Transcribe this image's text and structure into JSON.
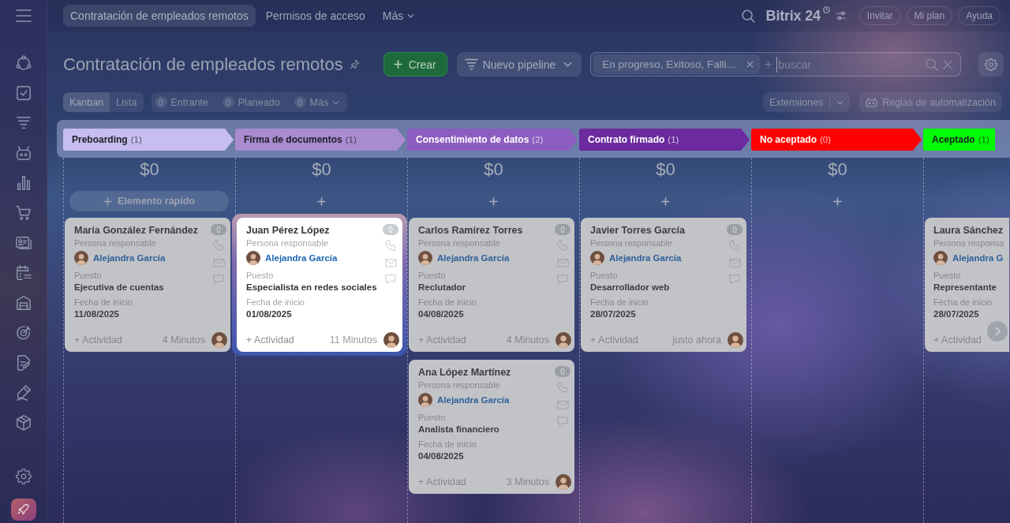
{
  "top_tabs": [
    {
      "label": "Contratación de empleados remotos",
      "kind": "tab",
      "selected": true
    },
    {
      "label": "Permisos de acceso",
      "kind": "tab",
      "selected": false
    },
    {
      "label": "Más",
      "kind": "menu",
      "selected": false
    }
  ],
  "header": {
    "logo": "Bitrix 24",
    "buttons": [
      "Invitar",
      "Mi plan",
      "Ayuda"
    ]
  },
  "page": {
    "title": "Contratación de empleados remotos",
    "create_button": "Crear",
    "pipeline_button": "Nuevo pipeline",
    "filter": {
      "tag": "En progreso, Exitoso, Falli...",
      "placeholder": "buscar"
    }
  },
  "views": [
    {
      "label": "Kanban",
      "selected": true
    },
    {
      "label": "Lista",
      "selected": false
    }
  ],
  "counters": [
    {
      "count": "0",
      "label": "Entrante",
      "kind": "counter"
    },
    {
      "count": "0",
      "label": "Planeado",
      "kind": "counter"
    },
    {
      "count": "0",
      "label": "Más",
      "kind": "menu"
    }
  ],
  "toolbar": {
    "extensions_button": "Extensiones",
    "automation_button": "Reglas de automatización"
  },
  "stages": [
    {
      "name": "Preboarding",
      "count": "(1)",
      "color": "#c7bdf0",
      "total": "$0",
      "add_label": "Elemento rápido",
      "clipped": false,
      "cards": [
        {
          "name": "María González Fernández",
          "badge": "0",
          "responsible_label": "Persona responsable",
          "responsible": "Alejandra García",
          "fields": [
            {
              "label": "Puesto",
              "value": "Ejecutiva de cuentas"
            },
            {
              "label": "Fecha de inicio",
              "value": "11/08/2025"
            }
          ],
          "activity": "+ Actividad",
          "time": "4 Minutos",
          "highlighted": false,
          "clipped": false
        }
      ]
    },
    {
      "name": "Firma de documentos",
      "count": "(1)",
      "color": "#a98bd0",
      "total": "$0",
      "clipped": false,
      "cards": [
        {
          "name": "Juan Pérez López",
          "badge": "0",
          "responsible_label": "Persona responsable",
          "responsible": "Alejandra García",
          "fields": [
            {
              "label": "Puesto",
              "value": "Especialista en redes sociales"
            },
            {
              "label": "Fecha de inicio",
              "value": "01/08/2025"
            }
          ],
          "activity": "+ Actividad",
          "time": "11 Minutos",
          "highlighted": true,
          "clipped": false
        }
      ]
    },
    {
      "name": "Consentimiento de datos",
      "count": "(2)",
      "color": "#8c5cc0",
      "total": "$0",
      "clipped": false,
      "cards": [
        {
          "name": "Carlos Ramírez Torres",
          "badge": "0",
          "responsible_label": "Persona responsable",
          "responsible": "Alejandra García",
          "fields": [
            {
              "label": "Puesto",
              "value": "Reclutador"
            },
            {
              "label": "Fecha de inicio",
              "value": "04/08/2025"
            }
          ],
          "activity": "+ Actividad",
          "time": "4 Minutos",
          "highlighted": false,
          "clipped": false
        },
        {
          "name": "Ana López Martínez",
          "badge": "0",
          "responsible_label": "Persona responsable",
          "responsible": "Alejandra García",
          "fields": [
            {
              "label": "Puesto",
              "value": "Analista financiero"
            },
            {
              "label": "Fecha de inicio",
              "value": "04/08/2025"
            }
          ],
          "activity": "+ Actividad",
          "time": "3 Minutos",
          "highlighted": false,
          "clipped": false
        }
      ]
    },
    {
      "name": "Contrato firmado",
      "count": "(1)",
      "color": "#6b2a9e",
      "total": "$0",
      "clipped": false,
      "cards": [
        {
          "name": "Javier Torres García",
          "badge": "0",
          "responsible_label": "Persona responsable",
          "responsible": "Alejandra García",
          "fields": [
            {
              "label": "Puesto",
              "value": "Desarrollador web"
            },
            {
              "label": "Fecha de inicio",
              "value": "28/07/2025"
            }
          ],
          "activity": "+ Actividad",
          "time": "justo ahora",
          "highlighted": false,
          "clipped": false
        }
      ]
    },
    {
      "name": "No aceptado",
      "count": "(0)",
      "color": "#ff0000",
      "total": "$0",
      "clipped": false
    },
    {
      "name": "Aceptado",
      "count": "(1)",
      "color": "#00ff00",
      "clipped": true,
      "cards": [
        {
          "name": "Laura Sánchez",
          "responsible_label": "Persona responsa",
          "responsible": "Alejandra G",
          "fields": [
            {
              "label": "Puesto",
              "value": "Representante"
            },
            {
              "label": "Fecha de inicio",
              "value": "28/07/2025"
            }
          ],
          "activity": "+ Actividad",
          "highlighted": false,
          "clipped": true
        }
      ]
    }
  ]
}
